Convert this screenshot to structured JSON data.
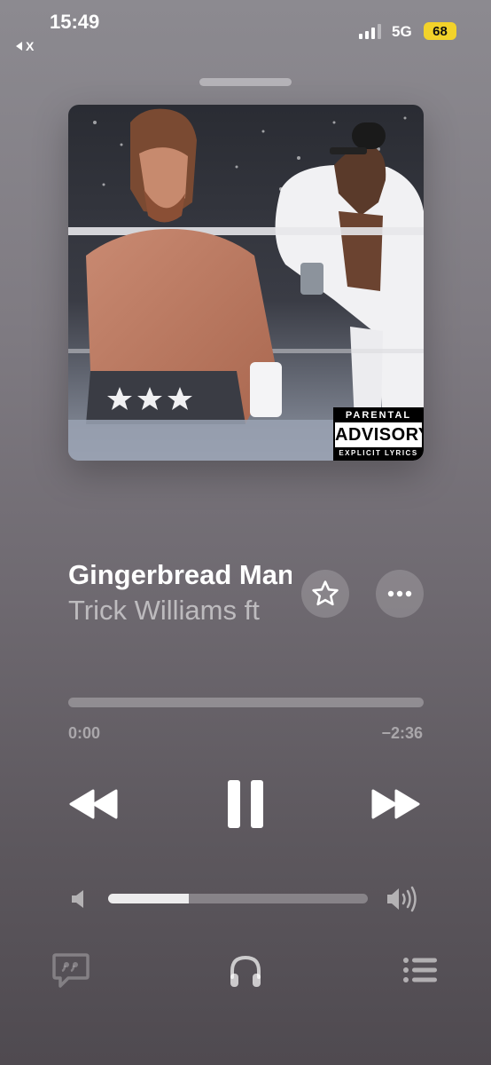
{
  "status_bar": {
    "time": "15:49",
    "back_label": "X",
    "network": "5G",
    "battery": "68"
  },
  "artwork": {
    "advisory_top": "PARENTAL",
    "advisory_mid": "ADVISORY",
    "advisory_bottom": "EXPLICIT LYRICS"
  },
  "track": {
    "title": "Gingerbread Man",
    "artist": "Trick Williams ft"
  },
  "playback": {
    "elapsed": "0:00",
    "remaining": "−2:36",
    "progress": 0.0,
    "volume": 0.31
  },
  "icons": {
    "favorite": "star-icon",
    "more": "ellipsis-icon",
    "rewind": "rewind-icon",
    "pause": "pause-icon",
    "forward": "fast-forward-icon",
    "volume_low": "speaker-low-icon",
    "volume_high": "speaker-high-icon",
    "lyrics": "lyrics-icon",
    "output": "headphones-icon",
    "queue": "queue-list-icon"
  },
  "colors": {
    "battery": "#f2d22a"
  }
}
